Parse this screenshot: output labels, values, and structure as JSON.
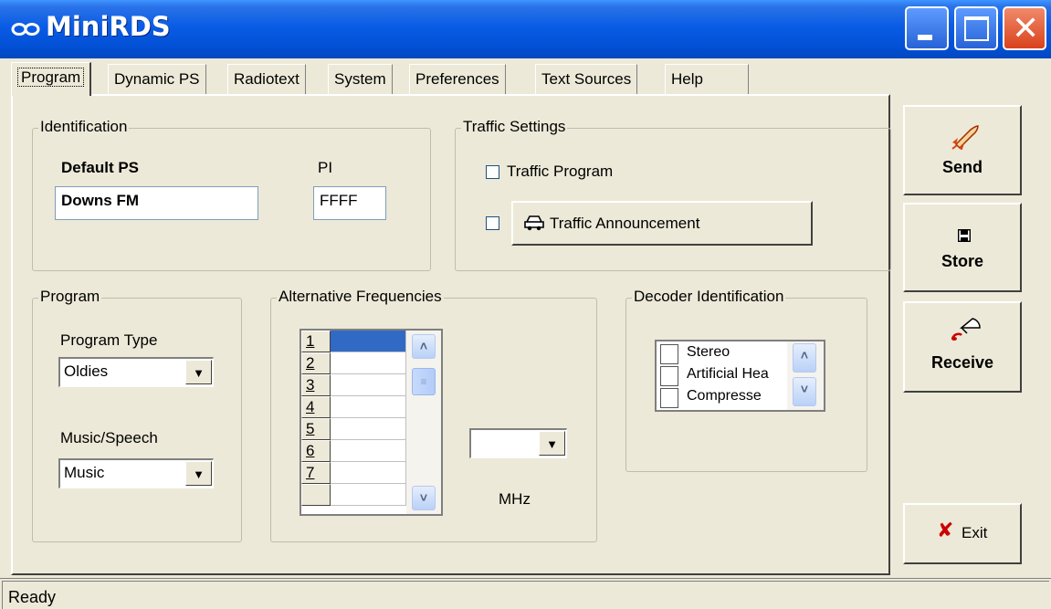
{
  "window": {
    "title": "MiniRDS",
    "colors": {
      "titlebar": "#0a5ce5",
      "face": "#ece9d8",
      "selection": "#316ac5",
      "close": "#d9421c"
    }
  },
  "tabs": [
    "Program",
    "Dynamic PS",
    "Radiotext",
    "System",
    "Preferences",
    "Text Sources",
    "Help"
  ],
  "active_tab": "Program",
  "identification": {
    "legend": "Identification",
    "default_ps_label": "Default PS",
    "default_ps_value": "Downs FM",
    "pi_label": "PI",
    "pi_value": "FFFF"
  },
  "traffic": {
    "legend": "Traffic Settings",
    "traffic_program_label": "Traffic Program",
    "traffic_program_checked": false,
    "traffic_announcement_checked": false,
    "traffic_announcement_button": "Traffic Announcement"
  },
  "program": {
    "legend": "Program",
    "program_type_label": "Program Type",
    "program_type_value": "Oldies",
    "music_speech_label": "Music/Speech",
    "music_speech_value": "Music"
  },
  "alt_freq": {
    "legend": "Alternative Frequencies",
    "rows": [
      "1",
      "2",
      "3",
      "4",
      "5",
      "6",
      "7"
    ],
    "selected_row": "1",
    "frequency_value": "",
    "unit_label": "MHz"
  },
  "decoder": {
    "legend": "Decoder Identification",
    "items": [
      "Stereo",
      "Artificial Hea",
      "Compresse"
    ]
  },
  "actions": {
    "send": "Send",
    "store": "Store",
    "receive": "Receive",
    "exit": "Exit"
  },
  "icons": [
    "infinity-logo-icon",
    "rocket-icon",
    "floppy-disk-icon",
    "satellite-dish-icon",
    "car-icon",
    "red-x-icon"
  ],
  "status": "Ready"
}
